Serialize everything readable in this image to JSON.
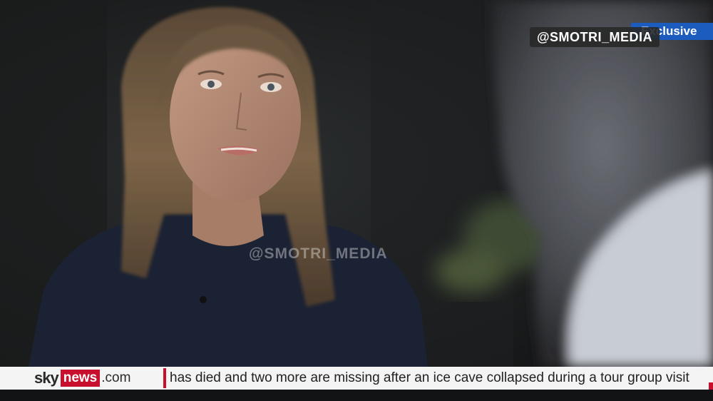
{
  "overlay": {
    "exclusive_label": "Exclusive",
    "watermark_corner": "@SMOTRI_MEDIA",
    "watermark_center": "@SMOTRI_MEDIA"
  },
  "ticker": {
    "brand_sky": "sky",
    "brand_news": "news",
    "brand_com": ".com",
    "headline": "has died and two more are missing after an ice cave collapsed during a tour group visit"
  },
  "colors": {
    "brand_red": "#c8102e",
    "exclusive_blue": "#1d5cbf",
    "ticker_background": "#f4f4f4"
  }
}
